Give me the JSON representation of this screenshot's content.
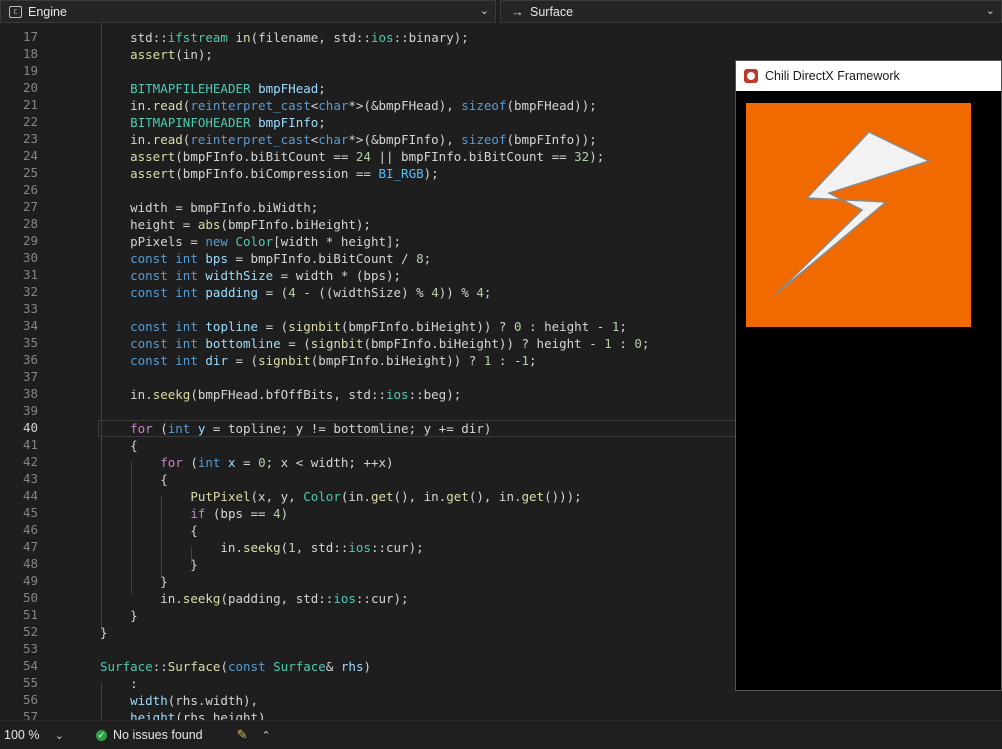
{
  "toolbar": {
    "left_dropdown": {
      "icon": "file-code-icon",
      "label": "Engine"
    },
    "right_dropdown": {
      "icon": "arrow-right-icon",
      "label": "Surface"
    }
  },
  "editor": {
    "current_line": "40",
    "lines": [
      {
        "num": "17",
        "segs": [
          [
            "p",
            "    "
          ],
          [
            "p",
            "std"
          ],
          [
            "p",
            "::"
          ],
          [
            "t",
            "ifstream"
          ],
          [
            "p",
            " "
          ],
          [
            "f",
            "in"
          ],
          [
            "p",
            "(filename, std::"
          ],
          [
            "ns",
            "ios"
          ],
          [
            "p",
            "::binary);"
          ]
        ]
      },
      {
        "num": "18",
        "segs": [
          [
            "p",
            "    "
          ],
          [
            "f",
            "assert"
          ],
          [
            "p",
            "(in);"
          ]
        ]
      },
      {
        "num": "19",
        "segs": []
      },
      {
        "num": "20",
        "segs": [
          [
            "p",
            "    "
          ],
          [
            "t",
            "BITMAPFILEHEADER"
          ],
          [
            "p",
            " "
          ],
          [
            "v",
            "bmpFHead"
          ],
          [
            "p",
            ";"
          ]
        ]
      },
      {
        "num": "21",
        "segs": [
          [
            "p",
            "    in."
          ],
          [
            "f",
            "read"
          ],
          [
            "p",
            "("
          ],
          [
            "k",
            "reinterpret_cast"
          ],
          [
            "p",
            "<"
          ],
          [
            "k",
            "char"
          ],
          [
            "p",
            "*>(&bmpFHead), "
          ],
          [
            "k",
            "sizeof"
          ],
          [
            "p",
            "(bmpFHead));"
          ]
        ]
      },
      {
        "num": "22",
        "segs": [
          [
            "p",
            "    "
          ],
          [
            "t",
            "BITMAPINFOHEADER"
          ],
          [
            "p",
            " "
          ],
          [
            "v",
            "bmpFInfo"
          ],
          [
            "p",
            ";"
          ]
        ]
      },
      {
        "num": "23",
        "segs": [
          [
            "p",
            "    in."
          ],
          [
            "f",
            "read"
          ],
          [
            "p",
            "("
          ],
          [
            "k",
            "reinterpret_cast"
          ],
          [
            "p",
            "<"
          ],
          [
            "k",
            "char"
          ],
          [
            "p",
            "*>(&bmpFInfo), "
          ],
          [
            "k",
            "sizeof"
          ],
          [
            "p",
            "(bmpFInfo));"
          ]
        ]
      },
      {
        "num": "24",
        "segs": [
          [
            "p",
            "    "
          ],
          [
            "f",
            "assert"
          ],
          [
            "p",
            "(bmpFInfo.biBitCount == "
          ],
          [
            "n",
            "24"
          ],
          [
            "p",
            " || bmpFInfo.biBitCount == "
          ],
          [
            "n",
            "32"
          ],
          [
            "p",
            ");"
          ]
        ]
      },
      {
        "num": "25",
        "segs": [
          [
            "p",
            "    "
          ],
          [
            "f",
            "assert"
          ],
          [
            "p",
            "(bmpFInfo.biCompression == "
          ],
          [
            "m",
            "BI_RGB"
          ],
          [
            "p",
            ");"
          ]
        ]
      },
      {
        "num": "26",
        "segs": []
      },
      {
        "num": "27",
        "segs": [
          [
            "p",
            "    width = bmpFInfo.biWidth;"
          ]
        ]
      },
      {
        "num": "28",
        "segs": [
          [
            "p",
            "    height = "
          ],
          [
            "f",
            "abs"
          ],
          [
            "p",
            "(bmpFInfo.biHeight);"
          ]
        ]
      },
      {
        "num": "29",
        "segs": [
          [
            "p",
            "    pPixels = "
          ],
          [
            "k",
            "new"
          ],
          [
            "p",
            " "
          ],
          [
            "t",
            "Color"
          ],
          [
            "p",
            "[width * height];"
          ]
        ]
      },
      {
        "num": "30",
        "segs": [
          [
            "p",
            "    "
          ],
          [
            "k",
            "const"
          ],
          [
            "p",
            " "
          ],
          [
            "k",
            "int"
          ],
          [
            "p",
            " "
          ],
          [
            "v",
            "bps"
          ],
          [
            "p",
            " = bmpFInfo.biBitCount / "
          ],
          [
            "n",
            "8"
          ],
          [
            "p",
            ";"
          ]
        ]
      },
      {
        "num": "31",
        "segs": [
          [
            "p",
            "    "
          ],
          [
            "k",
            "const"
          ],
          [
            "p",
            " "
          ],
          [
            "k",
            "int"
          ],
          [
            "p",
            " "
          ],
          [
            "v",
            "widthSize"
          ],
          [
            "p",
            " = width * (bps);"
          ]
        ]
      },
      {
        "num": "32",
        "segs": [
          [
            "p",
            "    "
          ],
          [
            "k",
            "const"
          ],
          [
            "p",
            " "
          ],
          [
            "k",
            "int"
          ],
          [
            "p",
            " "
          ],
          [
            "v",
            "padding"
          ],
          [
            "p",
            " = ("
          ],
          [
            "n",
            "4"
          ],
          [
            "p",
            " - ((widthSize) % "
          ],
          [
            "n",
            "4"
          ],
          [
            "p",
            ")) % "
          ],
          [
            "n",
            "4"
          ],
          [
            "p",
            ";"
          ]
        ]
      },
      {
        "num": "33",
        "segs": []
      },
      {
        "num": "34",
        "segs": [
          [
            "p",
            "    "
          ],
          [
            "k",
            "const"
          ],
          [
            "p",
            " "
          ],
          [
            "k",
            "int"
          ],
          [
            "p",
            " "
          ],
          [
            "v",
            "topline"
          ],
          [
            "p",
            " = ("
          ],
          [
            "f",
            "signbit"
          ],
          [
            "p",
            "(bmpFInfo.biHeight)) ? "
          ],
          [
            "n",
            "0"
          ],
          [
            "p",
            " : height - "
          ],
          [
            "n",
            "1"
          ],
          [
            "p",
            ";"
          ]
        ]
      },
      {
        "num": "35",
        "segs": [
          [
            "p",
            "    "
          ],
          [
            "k",
            "const"
          ],
          [
            "p",
            " "
          ],
          [
            "k",
            "int"
          ],
          [
            "p",
            " "
          ],
          [
            "v",
            "bottomline"
          ],
          [
            "p",
            " = ("
          ],
          [
            "f",
            "signbit"
          ],
          [
            "p",
            "(bmpFInfo.biHeight)) ? height - "
          ],
          [
            "n",
            "1"
          ],
          [
            "p",
            " : "
          ],
          [
            "n",
            "0"
          ],
          [
            "p",
            ";"
          ]
        ]
      },
      {
        "num": "36",
        "segs": [
          [
            "p",
            "    "
          ],
          [
            "k",
            "const"
          ],
          [
            "p",
            " "
          ],
          [
            "k",
            "int"
          ],
          [
            "p",
            " "
          ],
          [
            "v",
            "dir"
          ],
          [
            "p",
            " = ("
          ],
          [
            "f",
            "signbit"
          ],
          [
            "p",
            "(bmpFInfo.biHeight)) ? "
          ],
          [
            "n",
            "1"
          ],
          [
            "p",
            " : -"
          ],
          [
            "n",
            "1"
          ],
          [
            "p",
            ";"
          ]
        ]
      },
      {
        "num": "37",
        "segs": []
      },
      {
        "num": "38",
        "segs": [
          [
            "p",
            "    in."
          ],
          [
            "f",
            "seekg"
          ],
          [
            "p",
            "(bmpFHead.bfOffBits, std::"
          ],
          [
            "ns",
            "ios"
          ],
          [
            "p",
            "::beg);"
          ]
        ]
      },
      {
        "num": "39",
        "segs": []
      },
      {
        "num": "40",
        "segs": [
          [
            "p",
            "    "
          ],
          [
            "kf",
            "for"
          ],
          [
            "p",
            " ("
          ],
          [
            "k",
            "int"
          ],
          [
            "p",
            " "
          ],
          [
            "v",
            "y"
          ],
          [
            "p",
            " = topline; y != bottomline; y += dir)"
          ]
        ]
      },
      {
        "num": "41",
        "segs": [
          [
            "p",
            "    {"
          ]
        ]
      },
      {
        "num": "42",
        "segs": [
          [
            "p",
            "        "
          ],
          [
            "kf",
            "for"
          ],
          [
            "p",
            " ("
          ],
          [
            "k",
            "int"
          ],
          [
            "p",
            " "
          ],
          [
            "v",
            "x"
          ],
          [
            "p",
            " = "
          ],
          [
            "n",
            "0"
          ],
          [
            "p",
            "; x < width; ++x)"
          ]
        ]
      },
      {
        "num": "43",
        "segs": [
          [
            "p",
            "        {"
          ]
        ]
      },
      {
        "num": "44",
        "segs": [
          [
            "p",
            "            "
          ],
          [
            "f",
            "PutPixel"
          ],
          [
            "p",
            "(x, y, "
          ],
          [
            "t",
            "Color"
          ],
          [
            "p",
            "(in."
          ],
          [
            "f",
            "get"
          ],
          [
            "p",
            "(), in."
          ],
          [
            "f",
            "get"
          ],
          [
            "p",
            "(), in."
          ],
          [
            "f",
            "get"
          ],
          [
            "p",
            "()));"
          ]
        ]
      },
      {
        "num": "45",
        "segs": [
          [
            "p",
            "            "
          ],
          [
            "kf",
            "if"
          ],
          [
            "p",
            " (bps == "
          ],
          [
            "n",
            "4"
          ],
          [
            "p",
            ")"
          ]
        ]
      },
      {
        "num": "46",
        "segs": [
          [
            "p",
            "            {"
          ]
        ]
      },
      {
        "num": "47",
        "segs": [
          [
            "p",
            "                in."
          ],
          [
            "f",
            "seekg"
          ],
          [
            "p",
            "("
          ],
          [
            "n",
            "1"
          ],
          [
            "p",
            ", std::"
          ],
          [
            "ns",
            "ios"
          ],
          [
            "p",
            "::cur);"
          ]
        ]
      },
      {
        "num": "48",
        "segs": [
          [
            "p",
            "            }"
          ]
        ]
      },
      {
        "num": "49",
        "segs": [
          [
            "p",
            "        }"
          ]
        ]
      },
      {
        "num": "50",
        "segs": [
          [
            "p",
            "        in."
          ],
          [
            "f",
            "seekg"
          ],
          [
            "p",
            "(padding, std::"
          ],
          [
            "ns",
            "ios"
          ],
          [
            "p",
            "::cur);"
          ]
        ]
      },
      {
        "num": "51",
        "segs": [
          [
            "p",
            "    }"
          ]
        ]
      },
      {
        "num": "52",
        "segs": [
          [
            "p",
            "}"
          ]
        ]
      },
      {
        "num": "53",
        "segs": []
      },
      {
        "num": "54",
        "segs": [
          [
            "t",
            "Surface"
          ],
          [
            "p",
            "::"
          ],
          [
            "f",
            "Surface"
          ],
          [
            "p",
            "("
          ],
          [
            "k",
            "const"
          ],
          [
            "p",
            " "
          ],
          [
            "t",
            "Surface"
          ],
          [
            "p",
            "& "
          ],
          [
            "v",
            "rhs"
          ],
          [
            "p",
            ")"
          ]
        ]
      },
      {
        "num": "55",
        "segs": [
          [
            "p",
            "    :"
          ]
        ]
      },
      {
        "num": "56",
        "segs": [
          [
            "p",
            "    "
          ],
          [
            "v",
            "width"
          ],
          [
            "p",
            "(rhs.width),"
          ]
        ]
      },
      {
        "num": "57",
        "segs": [
          [
            "p",
            "    "
          ],
          [
            "v",
            "height"
          ],
          [
            "p",
            "(rhs.height)"
          ]
        ]
      }
    ]
  },
  "app_window": {
    "title": "Chili DirectX Framework",
    "icon": "chili-logo-icon",
    "canvas_color": "#f06a00",
    "bolt_color": "#f2f2f2"
  },
  "statusbar": {
    "zoom": "100 %",
    "issues": "No issues found",
    "issues_icon": "check-circle-icon",
    "cleanup_icon": "broom-icon",
    "up_icon": "chevron-up-icon"
  }
}
